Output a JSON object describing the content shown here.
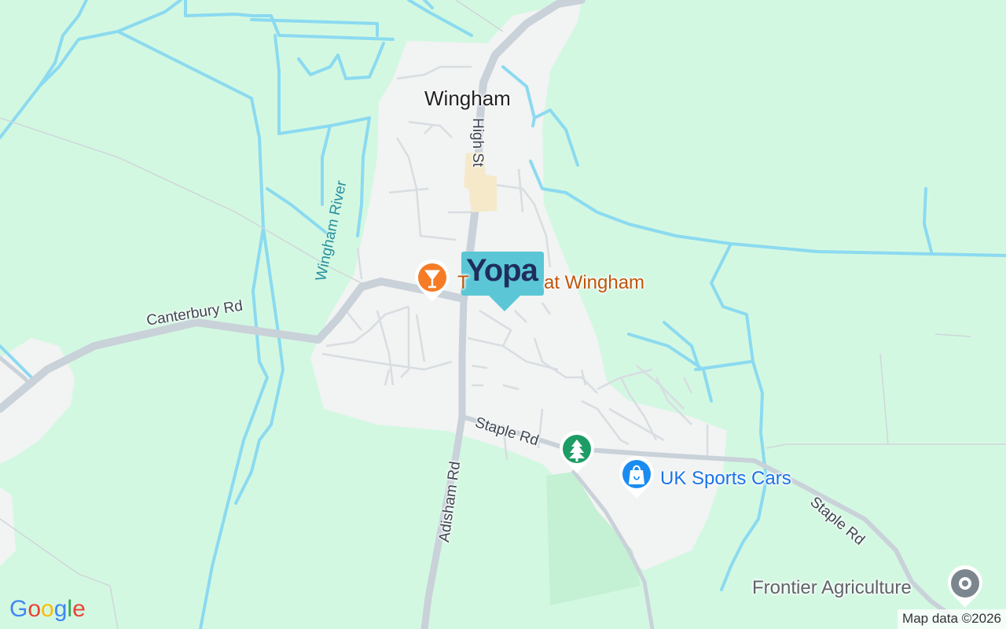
{
  "map": {
    "town_label": "Wingham",
    "roads": {
      "high_st": "High St",
      "canterbury_rd": "Canterbury Rd",
      "adisham_rd": "Adisham Rd",
      "staple_rd_west": "Staple Rd",
      "staple_rd_east": "Staple Rd"
    },
    "river_label": "Wingham River",
    "pois": {
      "bar_label": "T",
      "bar_label_suffix": "at Wingham",
      "shop_label": "UK Sports Cars",
      "agri_label": "Frontier Agriculture"
    },
    "marker": {
      "brand": "Yopa",
      "color": "#5bc7d6",
      "text_color": "#1f2d5c"
    },
    "attribution": "Map data ©2026",
    "logo": "Google",
    "icons": [
      "cocktail-icon",
      "tree-icon",
      "shopping-bag-icon",
      "location-dot-icon"
    ],
    "colors": {
      "land": "#d3f8e2",
      "urban": "#f2f3f3",
      "water": "#8bdaf0",
      "park": "#c4f0d4",
      "road": "#c9d1d9"
    }
  }
}
